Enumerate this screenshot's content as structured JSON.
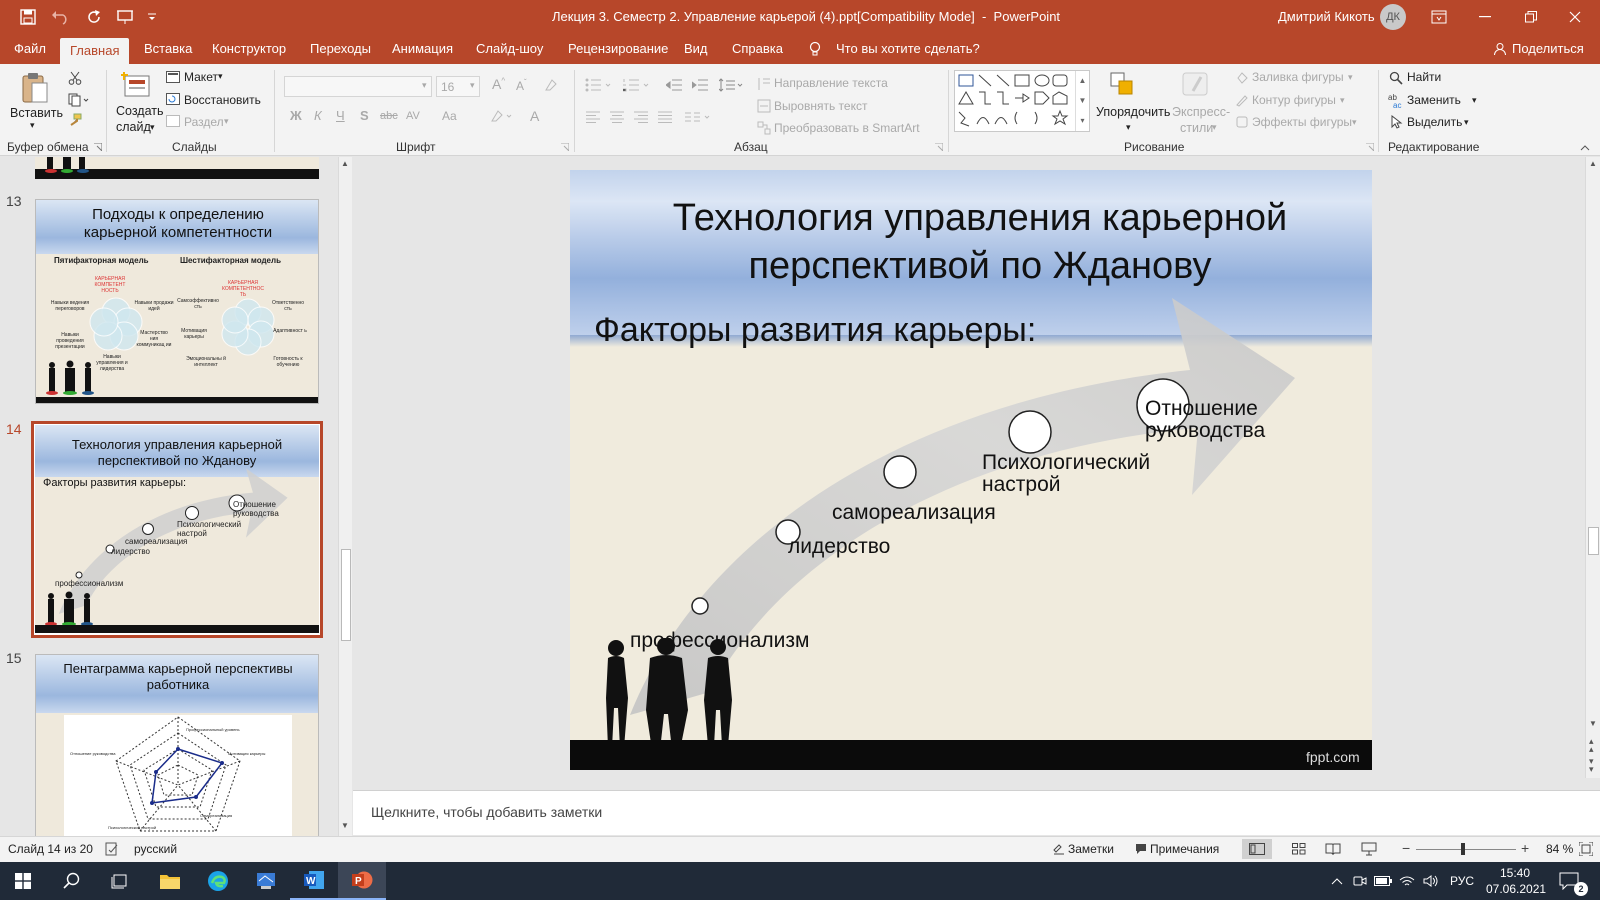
{
  "window": {
    "title": "Лекция 3. Семестр 2. Управление карьерой (4).ppt[Compatibility Mode]  -  PowerPoint",
    "user_name": "Дмитрий Кикоть",
    "user_initials": "ДК",
    "accent": "#b7472a"
  },
  "tabs": [
    "Файл",
    "Главная",
    "Вставка",
    "Конструктор",
    "Переходы",
    "Анимация",
    "Слайд-шоу",
    "Рецензирование",
    "Вид",
    "Справка"
  ],
  "tell_me": "Что вы хотите сделать?",
  "share": "Поделиться",
  "ribbon": {
    "clipboard": {
      "paste": "Вставить",
      "group": "Буфер обмена"
    },
    "slides": {
      "new_slide": "Создать",
      "new_slide2": "слайд",
      "layout": "Макет",
      "reset": "Восстановить",
      "section": "Раздел",
      "group": "Слайды"
    },
    "font": {
      "size": "16",
      "bold": "Ж",
      "italic": "К",
      "underline": "Ч",
      "shadow": "S",
      "strike": "abc",
      "spacing": "AV",
      "case": "Aa",
      "group": "Шрифт"
    },
    "paragraph": {
      "direction": "Направление текста",
      "align": "Выровнять текст",
      "smartart": "Преобразовать в SmartArt",
      "group": "Абзац"
    },
    "drawing": {
      "arrange": "Упорядочить",
      "quick_styles1": "Экспресс-",
      "quick_styles2": "стили",
      "fill": "Заливка фигуры",
      "outline": "Контур фигуры",
      "effects": "Эффекты фигуры",
      "group": "Рисование"
    },
    "editing": {
      "find": "Найти",
      "replace": "Заменить",
      "select": "Выделить",
      "group": "Редактирование"
    }
  },
  "thumbnails": [
    {
      "num": "13",
      "title": "Подходы к определению карьерной компетентности",
      "col1": "Пятифакторная модель",
      "col2": "Шестифакторная модель",
      "center1": "КАРЬЕРНАЯ КОМПЕТЕНТ НОСТЬ",
      "center2": "КАРЬЕРНАЯ КОМПЕТЕНТНОС ТЬ",
      "labels1": [
        "Навыки ведения переговоров",
        "Навыки продажи идей",
        "Навыки проведения презентации",
        "Мастерство ния коммуникац ии",
        "Навыки управления и лидерства"
      ],
      "labels2": [
        "Самоэффективно сть",
        "Ответственно сть",
        "Мотивация карьеры",
        "Адаптивност ь",
        "Эмоциональны й интеллект",
        "Готовность к обучению"
      ]
    },
    {
      "num": "14",
      "title": "Технология управления карьерной перспективой по Жданову",
      "subtitle": "Факторы развития карьеры:",
      "labels": [
        "профессионализм",
        "лидерство",
        "самореализация",
        "Психологический настрой",
        "Отношение руководства"
      ]
    },
    {
      "num": "15",
      "title": "Пентаграмма карьерной перспективы работника",
      "axes": [
        "Профессиональный уровень",
        "Мотивация карьеры",
        "Отношение руководства",
        "Психологический настрой",
        "Самореализация"
      ]
    }
  ],
  "slide": {
    "title": "Технология управления карьерной перспективой по Жданову",
    "subtitle": "Факторы развития карьеры:",
    "factors": [
      "профессионализм",
      "лидерство",
      "самореализация",
      "Психологический настрой",
      "Отношение руководства"
    ],
    "footer": "fppt.com"
  },
  "notes_placeholder": "Щелкните, чтобы добавить заметки",
  "status": {
    "slide_counter": "Слайд 14 из 20",
    "language": "русский",
    "notes": "Заметки",
    "comments": "Примечания",
    "zoom": "84 %",
    "zoom_level": 0.84
  },
  "taskbar": {
    "language": "РУС",
    "time": "15:40",
    "date": "07.06.2021",
    "notifications": "2"
  }
}
